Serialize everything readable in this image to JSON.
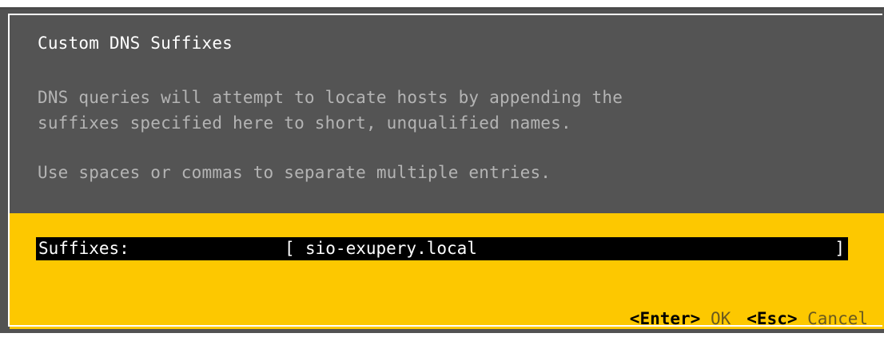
{
  "dialog": {
    "title": "Custom DNS Suffixes",
    "description_lines": [
      "DNS queries will attempt to locate hosts by appending the",
      "suffixes specified here to short, unqualified names."
    ],
    "hint": "Use spaces or commas to separate multiple entries."
  },
  "field": {
    "label": "Suffixes:",
    "bracket_open": "[",
    "value": "sio-exupery.local",
    "bracket_close": "]"
  },
  "footer": {
    "ok_key": "<Enter>",
    "ok_label": "OK",
    "cancel_key": "<Esc>",
    "cancel_label": "Cancel"
  },
  "colors": {
    "panel_gray": "#545454",
    "panel_yellow": "#fdc800",
    "title_text": "#ffffff",
    "description_text": "#b4b4b4",
    "field_background": "#000000"
  }
}
